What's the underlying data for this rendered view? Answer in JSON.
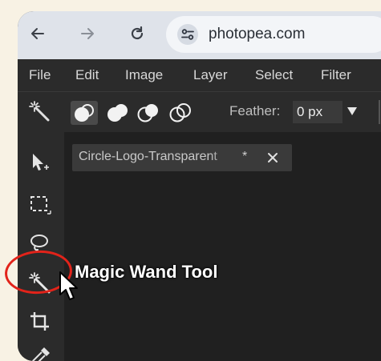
{
  "browser": {
    "url": "photopea.com",
    "back_icon": "arrow-left-icon",
    "forward_icon": "arrow-right-icon",
    "reload_icon": "reload-icon",
    "site_info_icon": "tune-icon"
  },
  "menu": {
    "items": [
      "File",
      "Edit",
      "Image",
      "Layer",
      "Select",
      "Filter"
    ]
  },
  "options": {
    "feather_label": "Feather:",
    "feather_value": "0 px"
  },
  "document": {
    "tab_title": "Circle-Logo-Transparent",
    "modified_marker": "*"
  },
  "tools": {
    "items": [
      "move-tool",
      "marquee-tool",
      "lasso-tool",
      "magic-wand-tool",
      "crop-tool",
      "eyedropper-tool"
    ],
    "active": "magic-wand-tool"
  },
  "annotation": {
    "callout_text": "Magic Wand Tool",
    "ring_color": "#e2231a"
  },
  "colors": {
    "accent": "#4a8cff",
    "panel": "#2b2b2b",
    "canvas": "#202020"
  }
}
